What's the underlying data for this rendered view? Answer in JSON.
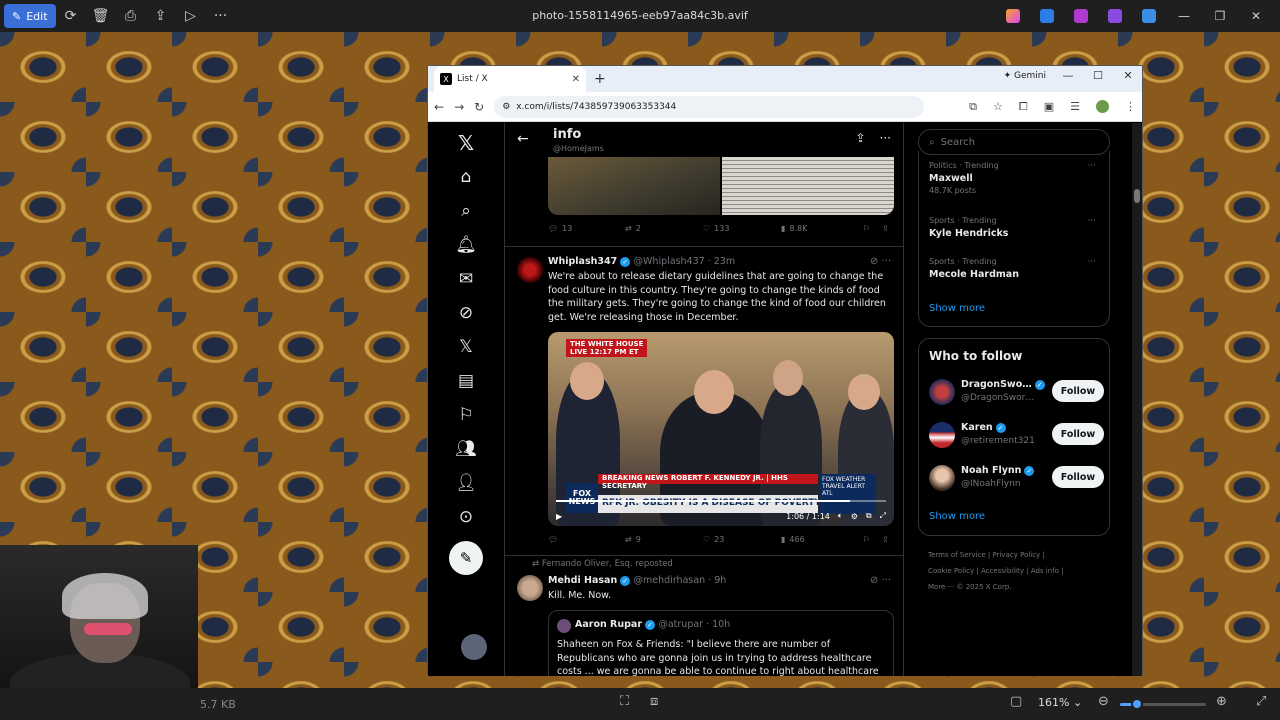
{
  "viewer": {
    "edit_label": "Edit",
    "filename": "photo-1558114965-eeb97aa84c3b.avif",
    "file_size": "5.7 KB",
    "zoom_value": "161%",
    "zoom_fraction": 0.2
  },
  "browser": {
    "tab_title": "List / X",
    "gemini_label": "Gemini",
    "url": "x.com/i/lists/743859739063353344"
  },
  "x_header": {
    "title": "info",
    "handle": "@HomeJams"
  },
  "tweet0_actions": {
    "replies": "13",
    "reposts": "2",
    "likes": "133",
    "views": "8.8K"
  },
  "tweet1": {
    "name": "Whiplash347",
    "meta": "@Whiplash437 · 23m",
    "text": "We're about to release dietary guidelines that are going to change the food culture in this country. They're going to change the kinds of food the military gets. They're going to change the kind of food our children get. We're releasing those in December.",
    "video": {
      "badge": "THE WHITE HOUSE",
      "badge_live": "LIVE",
      "badge_time": "12:17 PM ET",
      "breaking": "BREAKING NEWS",
      "subline": "ROBERT F. KENNEDY JR. | HHS SECRETARY",
      "chyron": "RFK JR: OBESITY IS A DISEASE OF POVERTY",
      "fox_line1": "FOX",
      "fox_line2": "NEWS",
      "weather_line1": "FOX WEATHER",
      "weather_line2": "TRAVEL ALERT",
      "weather_line3": "ATL",
      "time": "1:06 / 1:14",
      "progress": 0.89
    },
    "actions": {
      "replies": "",
      "reposts": "9",
      "likes": "23",
      "views": "466"
    }
  },
  "tweet2": {
    "repost_by": "Fernando Oliver, Esq. reposted",
    "name": "Mehdi Hasan",
    "meta": "@mehdirhasan · 9h",
    "text": "Kill. Me. Now.",
    "quote": {
      "name": "Aaron Rupar",
      "meta": "@atrupar · 10h",
      "text": "Shaheen on Fox & Friends: \"I believe there are number of Republicans who are gonna join us in trying to address healthcare costs ... we are gonna be able to continue to right about healthcare because we're"
    }
  },
  "sidebar": {
    "search_placeholder": "Search",
    "trends": [
      {
        "category": "Politics · Trending",
        "name": "Maxwell",
        "count": "48.7K posts"
      },
      {
        "category": "Sports · Trending",
        "name": "Kyle Hendricks",
        "count": ""
      },
      {
        "category": "Sports · Trending",
        "name": "Mecole Hardman",
        "count": ""
      }
    ],
    "show_more": "Show more",
    "wtf_title": "Who to follow",
    "follow": [
      {
        "name": "DragonSwo…",
        "handle": "@DragonSwor…",
        "button": "Follow"
      },
      {
        "name": "Karen",
        "handle": "@retirement321",
        "button": "Follow"
      },
      {
        "name": "Noah Flynn",
        "handle": "@INoahFlynn",
        "button": "Follow"
      }
    ],
    "wtf_show_more": "Show more",
    "footer": {
      "terms": "Terms of Service",
      "privacy": "Privacy Policy",
      "cookie": "Cookie Policy",
      "accessibility": "Accessibility",
      "ads": "Ads info",
      "more": "More ···",
      "copyright": "© 2025 X Corp."
    }
  }
}
